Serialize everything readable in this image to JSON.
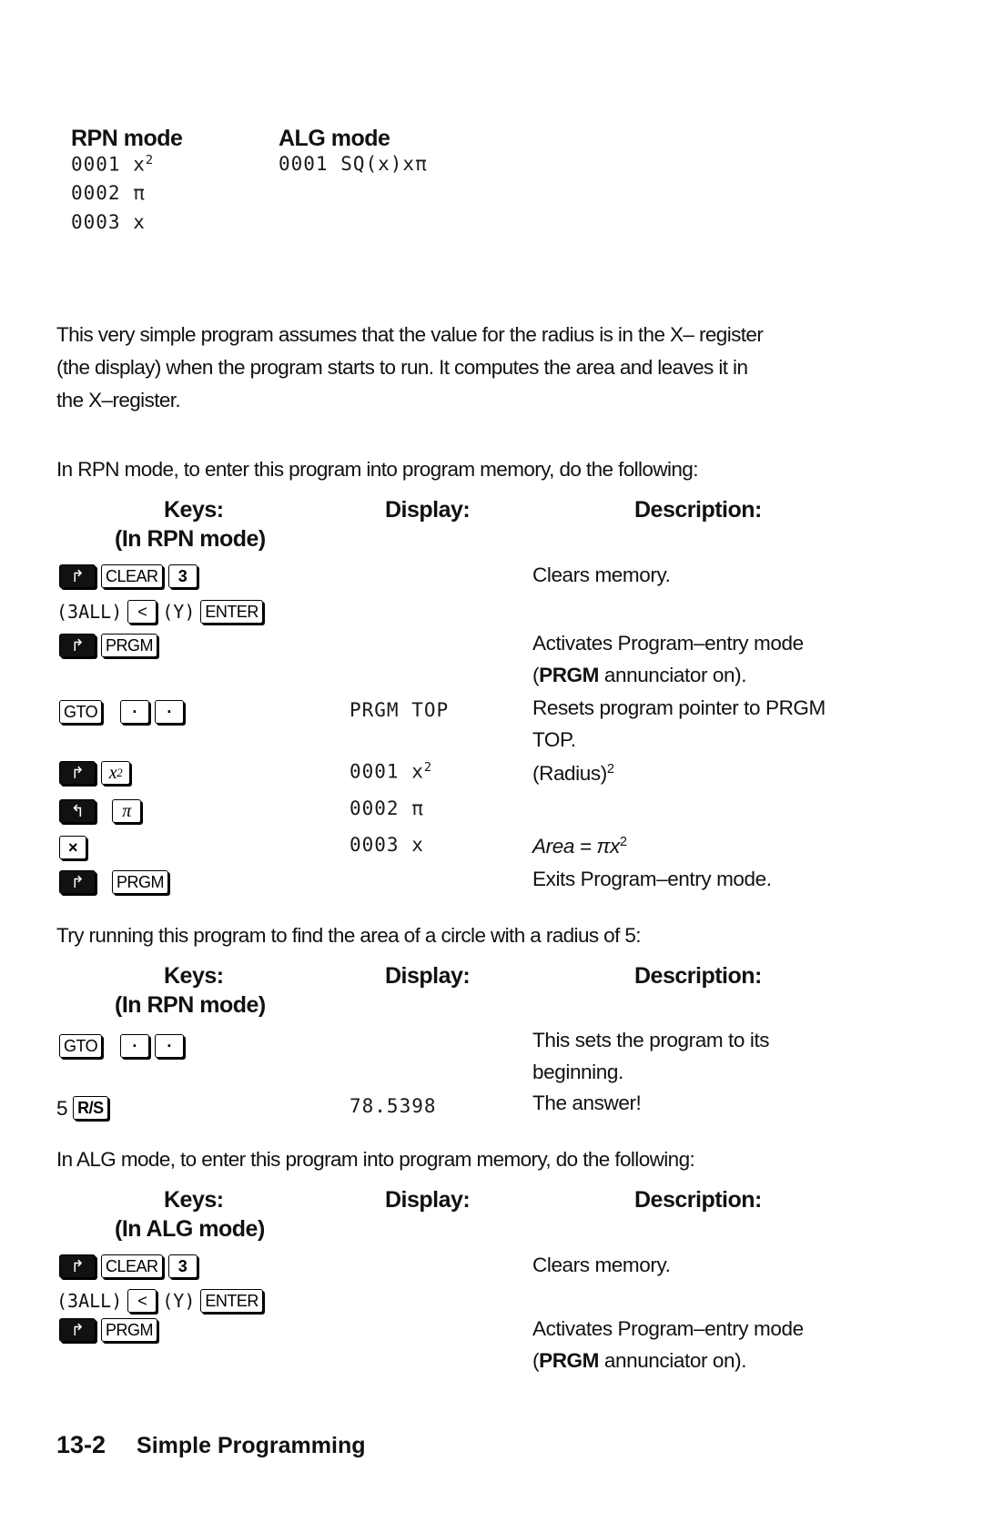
{
  "listing": {
    "rpn_title": "RPN mode",
    "alg_title": "ALG mode",
    "rpn_lines": [
      "0001 x",
      "0002 π",
      "0003 x"
    ],
    "rpn_line1_sup": "2",
    "alg_line": "0001 SQ(x)xπ"
  },
  "intro_paragraph": [
    "This very simple program assumes that the value for the radius is in the X– register",
    "(the display) when the program starts to run. It computes the area and leaves it in",
    "the X–register."
  ],
  "rpn_entry_intro": "In RPN mode, to enter this program into program memory, do the following:",
  "headers": {
    "keys": "Keys:",
    "display": "Display:",
    "description": "Description:",
    "rpn_mode": "(In RPN mode)",
    "alg_mode": "(In ALG mode)"
  },
  "keys": {
    "right_shift": "↱",
    "left_shift": "↰",
    "clear": "CLEAR",
    "three": "3",
    "all_label": "(3ALL)",
    "left_arrow": "<",
    "yes_label": "(Y)",
    "enter": "ENTER",
    "prgm": "PRGM",
    "gto": "GTO",
    "dot": "·",
    "x_squared": "x",
    "x_squared_sup": "2",
    "pi": "π",
    "times": "×",
    "rs": "R/S",
    "five": "5"
  },
  "rpn_table": {
    "desc_clears": "Clears memory.",
    "desc_activates_1": "Activates Program–entry mode",
    "desc_activates_bold": "PRGM",
    "desc_activates_2": " annunciator on).",
    "display_top": "PRGM TOP",
    "desc_resets": "Resets program pointer to PRGM",
    "desc_resets_2": "TOP.",
    "display_step1": "0001 x",
    "display_step1_sup": "2",
    "desc_radius": "(Radius)",
    "desc_radius_sup": "2",
    "display_step2": "0002 π",
    "display_step3": "0003 x",
    "desc_area": "Area = πx",
    "desc_area_sup": "2",
    "desc_exits": "Exits Program–entry mode."
  },
  "run_intro": "Try running this program to find the area of a circle with a radius of 5:",
  "run_table": {
    "desc_sets_1": "This sets the program to its",
    "desc_sets_2": "beginning.",
    "display_answer": "78.5398",
    "desc_answer": "The answer!"
  },
  "alg_entry_intro": "In ALG mode, to enter this program into program memory, do the following:",
  "alg_table": {
    "desc_clears": "Clears memory.",
    "desc_activates_1": "Activates Program–entry mode",
    "desc_activates_bold": "PRGM",
    "desc_activates_2": " annunciator on)."
  },
  "footer": {
    "page_number": "13-2",
    "chapter_title": "Simple Programming"
  }
}
